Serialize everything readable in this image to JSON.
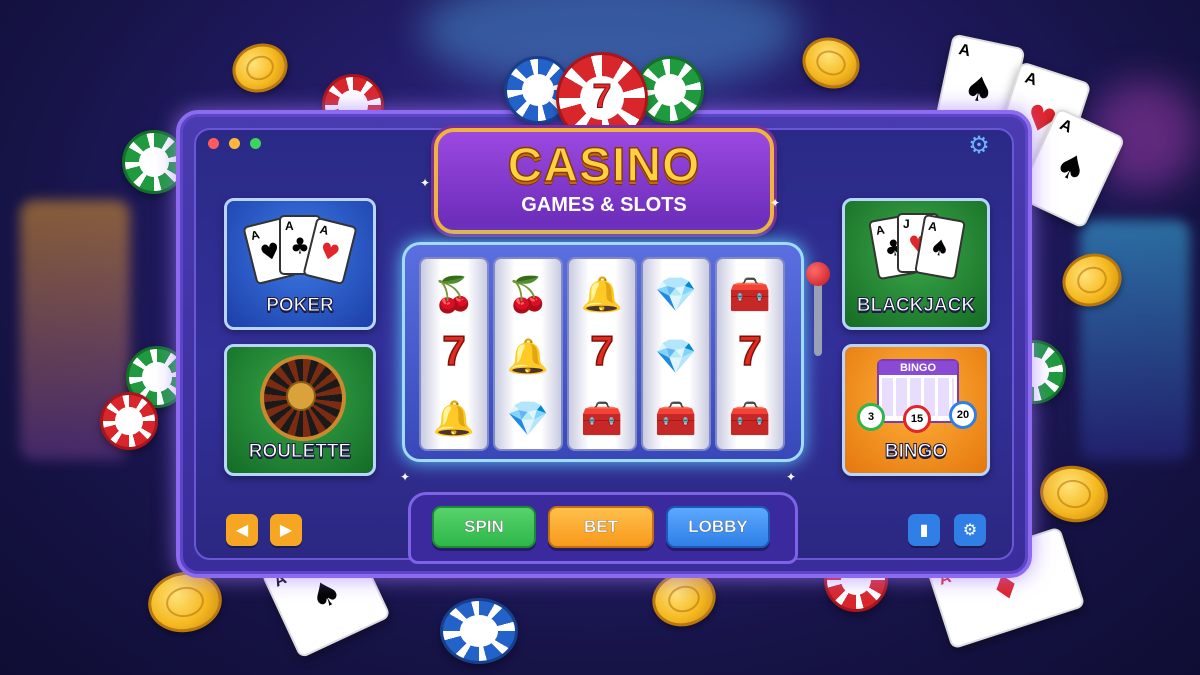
{
  "app": {
    "title": "CASINO",
    "subtitle": "GAMES & SLOTS"
  },
  "window_controls": [
    "close",
    "minimize",
    "maximize"
  ],
  "colors": {
    "accent_purple": "#8d6af0",
    "gold": "#ffd23f",
    "spin_green": "#2fb74a",
    "bet_orange": "#f79a1c",
    "lobby_blue": "#2f7fe6"
  },
  "games": {
    "poker": {
      "label": "POKER",
      "icon": "playing-cards-icon"
    },
    "roulette": {
      "label": "ROULETTE",
      "icon": "roulette-wheel-icon"
    },
    "blackjack": {
      "label": "BLACKJACK",
      "icon": "playing-cards-icon"
    },
    "bingo": {
      "label": "BINGO",
      "card_title": "BINGO",
      "balls": [
        "3",
        "15",
        "20"
      ],
      "icon": "bingo-card-icon"
    }
  },
  "card_ranks": {
    "poker": [
      "A",
      "A",
      "A"
    ],
    "blackjack": [
      "A",
      "J",
      "A"
    ],
    "corners": [
      "A",
      "A",
      "A",
      "A"
    ]
  },
  "top_chip_label": "7",
  "reels": [
    [
      "cherry",
      "seven",
      "bell"
    ],
    [
      "cherry",
      "bell",
      "diamond"
    ],
    [
      "bell",
      "seven",
      "chest"
    ],
    [
      "diamond",
      "diamond",
      "chest"
    ],
    [
      "chest",
      "seven",
      "chest"
    ]
  ],
  "seven_label": "7",
  "actions": {
    "spin": "SPIN",
    "bet": "BET",
    "lobby": "LOBBY"
  },
  "nav": {
    "prev_icon": "chevron-left-icon",
    "next_icon": "chevron-right-icon",
    "stats_icon": "bar-chart-icon",
    "settings_icon": "gear-icon"
  }
}
